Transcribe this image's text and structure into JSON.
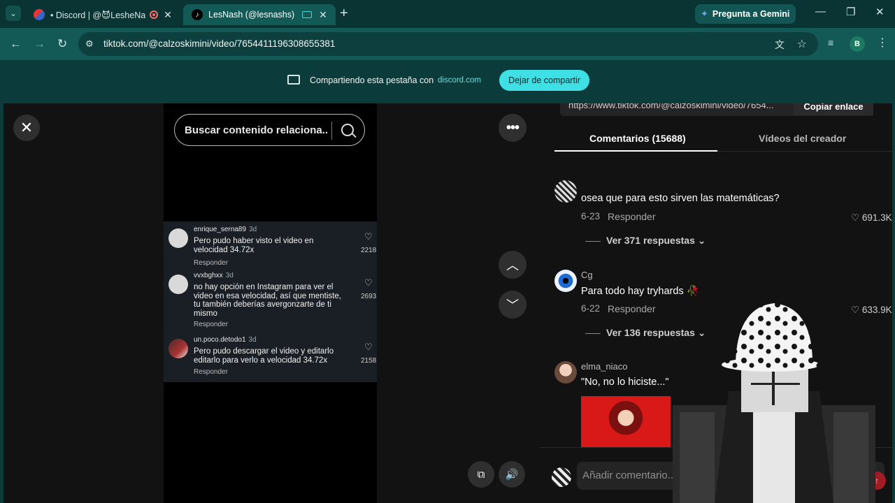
{
  "browser": {
    "tabs": [
      {
        "title": "• Discord | @😈LesheNash",
        "active": false
      },
      {
        "title": "LesNash (@lesnashs) | TikTo",
        "active": true
      }
    ],
    "gemini_label": "Pregunta a Gemini",
    "profile_initial": "B",
    "url": "tiktok.com/@calzoskimini/video/7654411196308655381"
  },
  "sharebar": {
    "message": "Compartiendo esta pestaña con",
    "domain": "discord.com",
    "stop_label": "Dejar de compartir"
  },
  "player": {
    "search_placeholder": "Buscar contenido relaciona...",
    "embedded_comments": [
      {
        "user": "enrique_serna89",
        "age": "3d",
        "text": "Pero pudo haber visto el video en velocidad 34.72x",
        "reply": "Responder",
        "likes": "2218"
      },
      {
        "user": "vvxbghxx",
        "age": "3d",
        "text": "no hay opción en Instagram para ver el video en esa velocidad, así que mentiste, tu también deberías avergonzarte de ti mismo",
        "reply": "Responder",
        "likes": "2693"
      },
      {
        "user": "un.poco.detodo1",
        "age": "3d",
        "text": "Pero pudo descargar el video y editarlo editarlo para verlo a velocidad 34.72x",
        "reply": "Responder",
        "likes": "2158"
      }
    ]
  },
  "panel": {
    "share_url": "https://www.tiktok.com/@calzoskimini/video/7654...",
    "copy_label": "Copiar enlace",
    "tabs": {
      "comments": "Comentarios (15688)",
      "creator": "Vídeos del creador"
    },
    "comments": [
      {
        "user": "",
        "text": "osea que para esto sirven las matemáticas?",
        "date": "6-23",
        "reply": "Responder",
        "likes": "691.3K",
        "replies": "Ver 371 respuestas"
      },
      {
        "user": "Cg",
        "text": "Para todo hay tryhards 🥀",
        "date": "6-22",
        "reply": "Responder",
        "likes": "633.9K",
        "replies": "Ver 136 respuestas"
      },
      {
        "user": "elma_niaco",
        "text": "\"No, no lo hiciste...\""
      }
    ],
    "compose_placeholder": "Añadir comentario..."
  },
  "icons": {
    "close": "close-icon",
    "search": "search-icon",
    "more": "more-icon",
    "up": "chevron-up-icon",
    "down": "chevron-down-icon",
    "pip": "picture-in-picture-icon",
    "volume": "volume-icon",
    "heart": "heart-icon"
  },
  "colors": {
    "accent": "#3ee0e6",
    "chrome_bg": "#0a3434",
    "tiktok_send": "#a11a24"
  }
}
